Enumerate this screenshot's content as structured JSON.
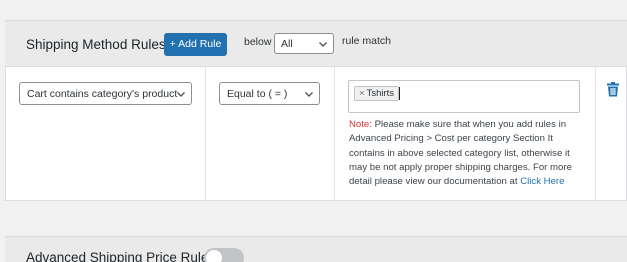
{
  "rules_header": {
    "title": "Shipping Method Rules",
    "add_rule_label": "+ Add Rule",
    "below_label": "below",
    "match_selected": "All",
    "rule_match_label": "rule match"
  },
  "rule_row": {
    "condition_selected": "Cart contains category's product",
    "operator_selected": "Equal to ( = )",
    "tags": [
      {
        "remove_symbol": "×",
        "label": "Tshirts"
      }
    ],
    "note_label": "Note:",
    "note_text": "Please make sure that when you add rules in Advanced Pricing > Cost per category Section It contains in above selected category list, otherwise it may be not apply proper shipping charges. For more detail please view our documentation at",
    "note_link": "Click Here"
  },
  "advanced_section": {
    "title": "Advanced Shipping Price Rules",
    "toggle_on": false
  },
  "colors": {
    "accent": "#2271b1",
    "note_label": "#d63638",
    "panel_bg": "#eaeaea",
    "page_bg": "#f1f1f1",
    "toggle_off": "#c3c4c7"
  },
  "icons": {
    "select_arrow": "chevron-down-icon",
    "delete_rule": "trash-icon"
  }
}
